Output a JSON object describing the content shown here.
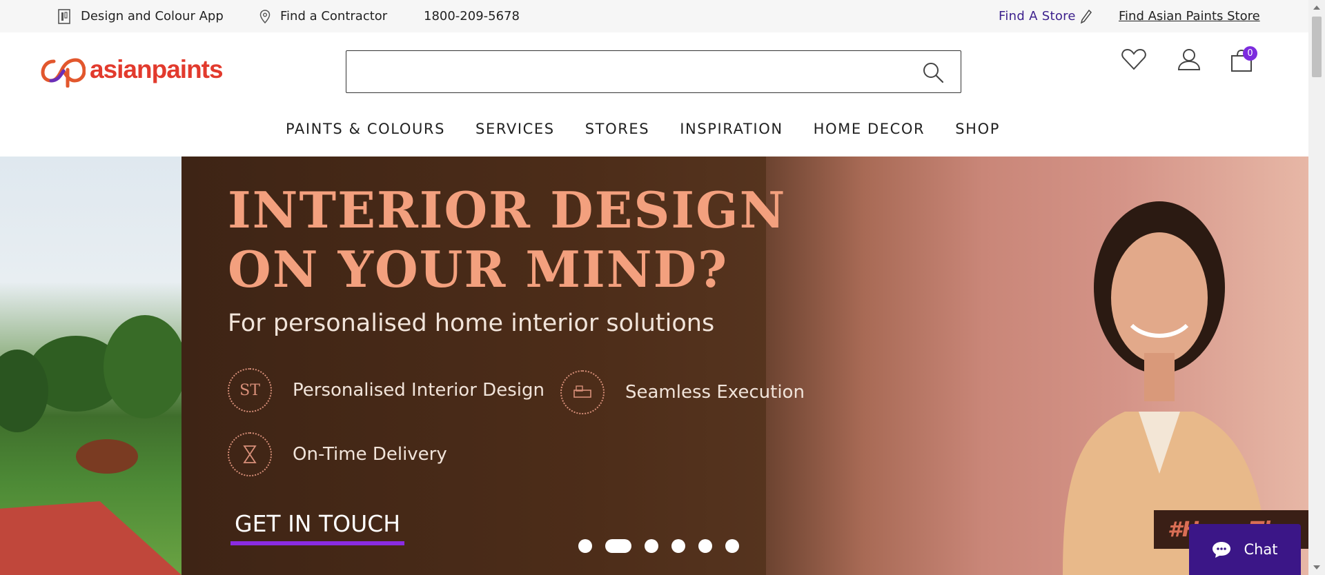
{
  "topbar": {
    "design_app": "Design and Colour App",
    "find_contractor": "Find a Contractor",
    "phone": "1800-209-5678",
    "find_a_store": "Find A Store",
    "find_asian_store": "Find Asian Paints Store"
  },
  "header": {
    "logo_text": "asianpaints",
    "search": {
      "value": "",
      "placeholder": ""
    },
    "cart_count": "0"
  },
  "nav": {
    "items": [
      "PAINTS & COLOURS",
      "SERVICES",
      "STORES",
      "INSPIRATION",
      "HOME DECOR",
      "SHOP"
    ]
  },
  "hero": {
    "title_line1": "INTERIOR DESIGN",
    "title_line2": "ON YOUR MIND?",
    "subtitle": "For personalised home interior solutions",
    "features": [
      "Personalised Interior Design",
      "Seamless Execution",
      "On-Time Delivery"
    ],
    "cta": "GET IN TOUCH",
    "hashtag": "#HomeTha",
    "slide_count": 6,
    "active_slide": 2
  },
  "chat": {
    "label": "Chat"
  },
  "colors": {
    "accent_purple": "#7c2cde",
    "brand_red": "#e23a2d",
    "hero_title": "#f3a07e",
    "chat_bg": "#3b1687"
  }
}
